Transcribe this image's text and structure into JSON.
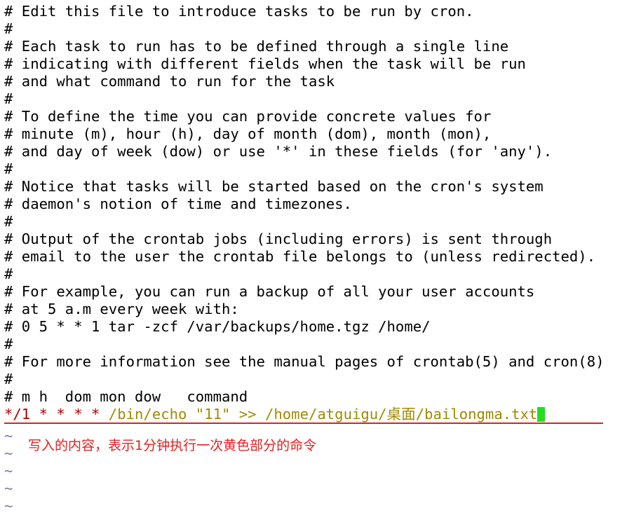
{
  "comments": [
    "# Edit this file to introduce tasks to be run by cron.",
    "#",
    "# Each task to run has to be defined through a single line",
    "# indicating with different fields when the task will be run",
    "# and what command to run for the task",
    "#",
    "# To define the time you can provide concrete values for",
    "# minute (m), hour (h), day of month (dom), month (mon),",
    "# and day of week (dow) or use '*' in these fields (for 'any').",
    "#",
    "# Notice that tasks will be started based on the cron's system",
    "# daemon's notion of time and timezones.",
    "#",
    "# Output of the crontab jobs (including errors) is sent through",
    "# email to the user the crontab file belongs to (unless redirected).",
    "#",
    "# For example, you can run a backup of all your user accounts",
    "# at 5 a.m every week with:",
    "# 0 5 * * 1 tar -zcf /var/backups/home.tgz /home/",
    "#",
    "# For more information see the manual pages of crontab(5) and cron(8)",
    "#",
    "# m h  dom mon dow   command"
  ],
  "cron_entry": {
    "schedule_minute": "*/1",
    "schedule_rest": " * * * *",
    "command": " /bin/echo \"11\" >> /home/atguigu/桌面/bailongma.txt"
  },
  "empty_line_markers": [
    "~",
    "~",
    "~",
    "~",
    "~"
  ],
  "annotation": "写入的内容，表示1分钟执行一次黄色部分的命令",
  "colors": {
    "schedule_minute": "#b00000",
    "schedule_fields": "#b00000",
    "command_text": "#a08a00",
    "cursor": "#22dd22",
    "annotation": "#e02020",
    "tilde": "#7a7aaa"
  }
}
